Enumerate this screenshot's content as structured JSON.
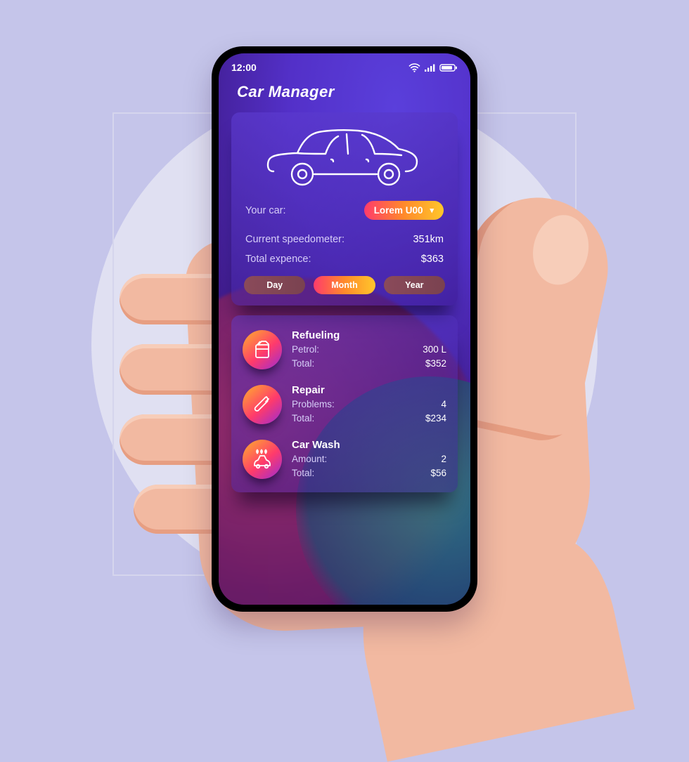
{
  "statusbar": {
    "time": "12:00"
  },
  "app": {
    "title": "Car Manager"
  },
  "car": {
    "your_car_label": "Your car:",
    "selected": "Lorem U00",
    "speedometer_label": "Current speedometer:",
    "speedometer_value": "351km",
    "expense_label": "Total expence:",
    "expense_value": "$363"
  },
  "segments": {
    "day": "Day",
    "month": "Month",
    "year": "Year",
    "active": "month"
  },
  "categories": [
    {
      "icon": "fuel-can-icon",
      "title": "Refueling",
      "line1_label": "Petrol:",
      "line1_value": "300 L",
      "line2_label": "Total:",
      "line2_value": "$352"
    },
    {
      "icon": "wrench-icon",
      "title": "Repair",
      "line1_label": "Problems:",
      "line1_value": "4",
      "line2_label": "Total:",
      "line2_value": "$234"
    },
    {
      "icon": "car-wash-icon",
      "title": "Car Wash",
      "line1_label": "Amount:",
      "line1_value": "2",
      "line2_label": "Total:",
      "line2_value": "$56"
    }
  ]
}
